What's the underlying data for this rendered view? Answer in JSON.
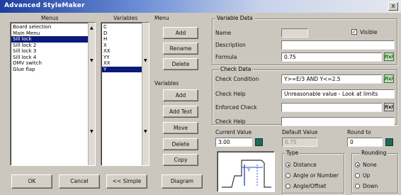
{
  "window": {
    "title": "Advanced StyleMaker",
    "close_label": "x"
  },
  "menus": {
    "label": "Menus",
    "items": [
      "Board selection",
      "Main Menu",
      "Sill lock",
      "Sill lock 2",
      "Sill lock 3",
      "Sill lock 4",
      "OMV switch",
      "Glue flap"
    ],
    "selected_index": 2
  },
  "variables": {
    "label": "Variables",
    "items": [
      "C",
      "D",
      "H",
      "X",
      "XX",
      "YY",
      "XX",
      "Y"
    ],
    "selected_index": 7
  },
  "menu_group": {
    "title": "Menu",
    "add": "Add",
    "rename": "Rename",
    "delete": "Delete"
  },
  "variables_group": {
    "title": "Variables",
    "add": "Add",
    "add_text": "Add Text",
    "move": "Move",
    "delete": "Delete",
    "copy": "Copy"
  },
  "bottom_buttons": {
    "ok": "OK",
    "cancel": "Cancel",
    "simple": "<< Simple",
    "diagram": "Diagram"
  },
  "variable_data": {
    "title": "Variable Data",
    "name_label": "Name",
    "name_value": "",
    "visible_label": "Visible",
    "visible_checked": true,
    "description_label": "Description",
    "description_value": "",
    "formula_label": "Formula",
    "formula_value": "0.75",
    "fx_label": "f(x)"
  },
  "check_data": {
    "title": "Check Data",
    "condition_label": "Check Condition",
    "condition_value": "Y>=E/3 AND Y<=2.5",
    "help_label": "Check Help",
    "help_value": "Unreasonable value - Look at limits",
    "enforced_label": "Enforced Check",
    "enforced_value": "",
    "help2_label": "Check Help",
    "help2_value": ""
  },
  "values": {
    "current_label": "Current Value",
    "current_value": "3.00",
    "default_label": "Default Value",
    "default_value": "0.75",
    "round_label": "Round to",
    "round_value": "0"
  },
  "type_group": {
    "title": "Type",
    "options": [
      "Distance",
      "Angle or Number",
      "Angle/Offset"
    ],
    "selected": 0
  },
  "rounding_group": {
    "title": "Rounding",
    "options": [
      "None",
      "Up",
      "Down"
    ],
    "selected": 0
  },
  "preview": {
    "label_y": "Y"
  },
  "colors": {
    "selection": "#0a1a7a",
    "fx_green": "#bfe5b6",
    "swatch": "#1e6a5a",
    "preview_blue": "#2a4fd0"
  }
}
